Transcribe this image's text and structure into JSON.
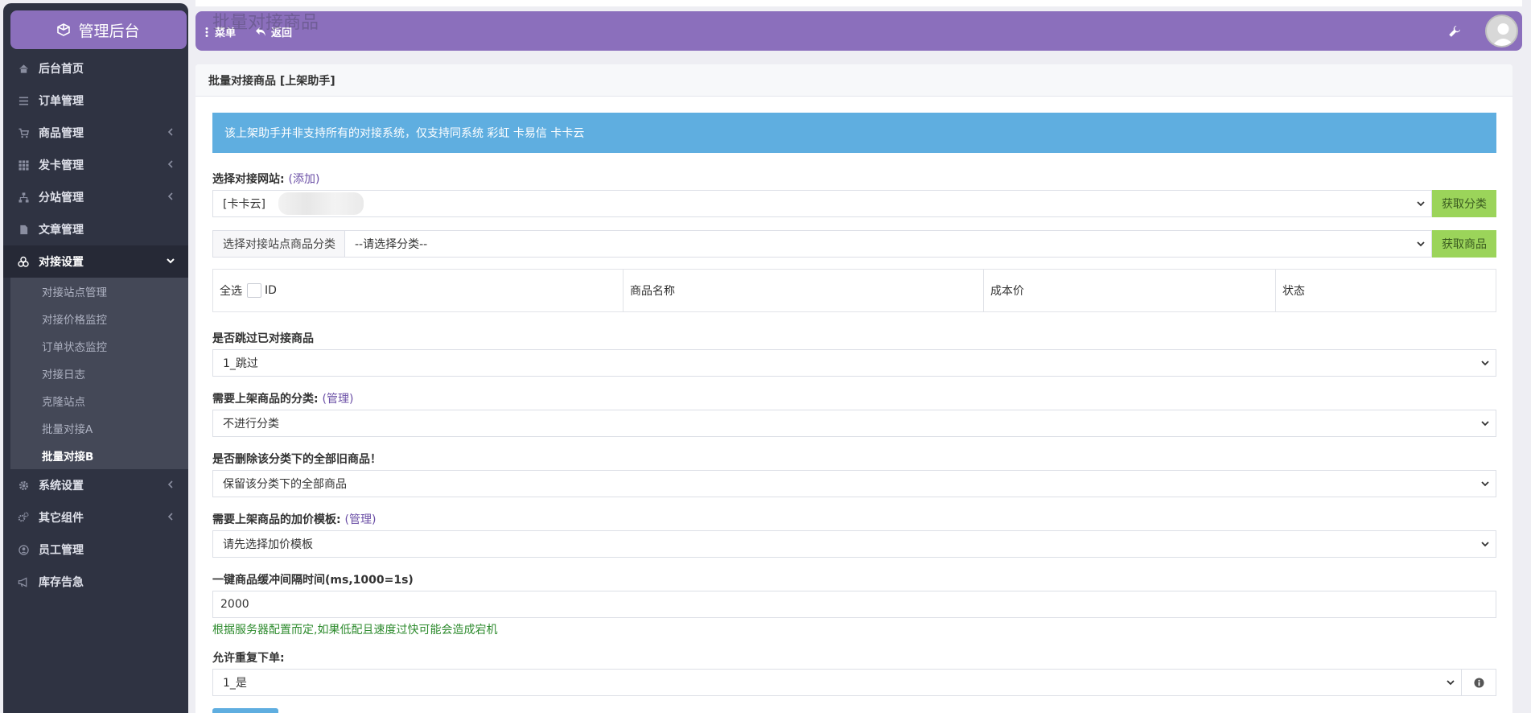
{
  "sidebar": {
    "brand": "管理后台",
    "items": [
      {
        "label": "后台首页",
        "icon": "home-icon"
      },
      {
        "label": "订单管理",
        "icon": "list-icon"
      },
      {
        "label": "商品管理",
        "icon": "cart-icon",
        "expandable": true
      },
      {
        "label": "发卡管理",
        "icon": "grid-icon",
        "expandable": true
      },
      {
        "label": "分站管理",
        "icon": "sitemap-icon",
        "expandable": true
      },
      {
        "label": "文章管理",
        "icon": "document-icon"
      },
      {
        "label": "对接设置",
        "icon": "cubes-icon",
        "expanded": true
      },
      {
        "label": "系统设置",
        "icon": "gear-icon",
        "expandable": true
      },
      {
        "label": "其它组件",
        "icon": "gears-icon",
        "expandable": true
      },
      {
        "label": "员工管理",
        "icon": "user-icon"
      },
      {
        "label": "库存告急",
        "icon": "megaphone-icon"
      }
    ],
    "sub_items": [
      "对接站点管理",
      "对接价格监控",
      "订单状态监控",
      "对接日志",
      "克隆站点",
      "批量对接A",
      "批量对接B"
    ],
    "active_sub": "批量对接B"
  },
  "topbar": {
    "menu_label": "菜单",
    "back_label": "返回",
    "ghost_title": "批量对接商品"
  },
  "panel": {
    "title": "批量对接商品 [上架助手]",
    "notice": "该上架助手并非支持所有的对接系统，仅支持同系统 彩虹 卡易信 卡卡云",
    "site_label": "选择对接网站:",
    "site_add_link": "(添加)",
    "site_value": "[卡卡云]",
    "get_category_btn": "获取分类",
    "category_addon": "选择对接站点商品分类",
    "category_value": "--请选择分类--",
    "get_goods_btn": "获取商品",
    "table": {
      "select_all": "全选",
      "columns": [
        "ID",
        "商品名称",
        "成本价",
        "状态"
      ]
    },
    "skip_label": "是否跳过已对接商品",
    "skip_value": "1_跳过",
    "target_category_label": "需要上架商品的分类:",
    "manage_link": "(管理)",
    "target_category_value": "不进行分类",
    "delete_label": "是否删除该分类下的全部旧商品！",
    "delete_value": "保留该分类下的全部商品",
    "price_template_label": "需要上架商品的加价模板:",
    "price_template_value": "请先选择加价模板",
    "interval_label": "一键商品缓冲间隔时间(ms,1000=1s)",
    "interval_value": "2000",
    "interval_hint": "根据服务器配置而定,如果低配且速度过快可能会造成宕机",
    "repeat_label": "允许重复下单:",
    "repeat_value": "1_是"
  },
  "colors": {
    "accent": "#8b6fbc",
    "sidebar_bg": "#2f3342",
    "notice_bg": "#5faee0",
    "button_green": "#9bd45a"
  }
}
